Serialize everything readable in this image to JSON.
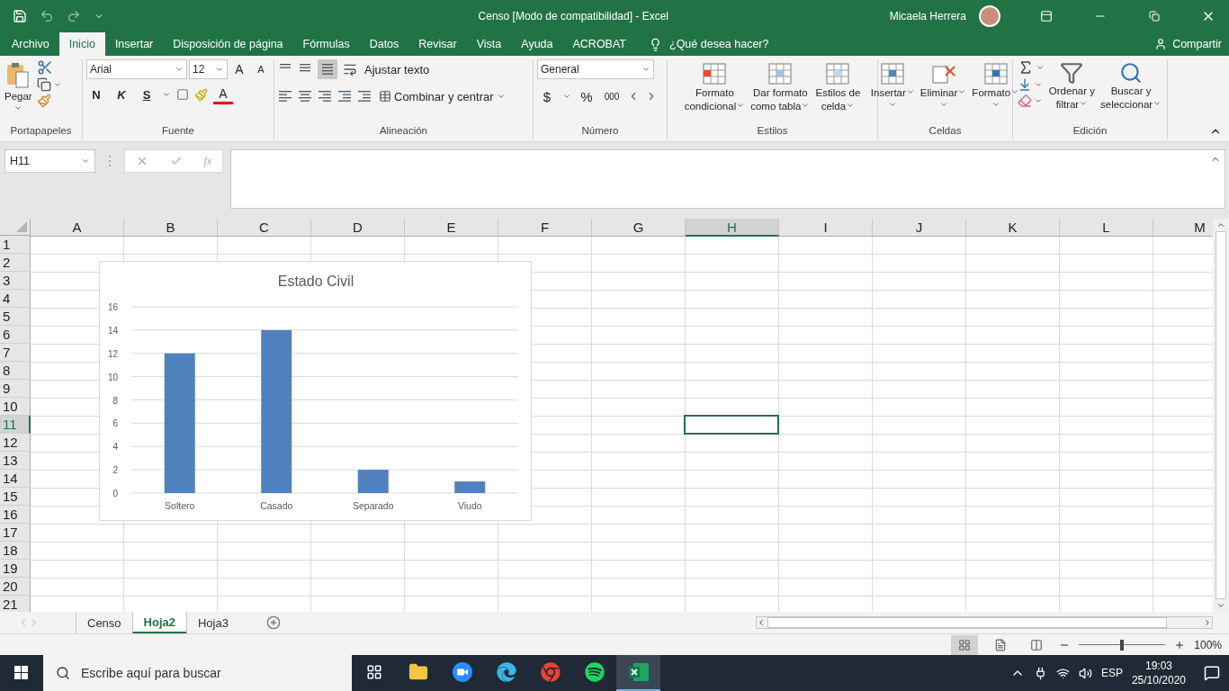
{
  "title_bar": {
    "title": "Censo  [Modo de compatibilidad]  -  Excel",
    "user": "Micaela Herrera"
  },
  "ribbon_tabs": [
    {
      "label": "Archivo",
      "selected": false
    },
    {
      "label": "Inicio",
      "selected": true
    },
    {
      "label": "Insertar",
      "selected": false
    },
    {
      "label": "Disposición de página",
      "selected": false
    },
    {
      "label": "Fórmulas",
      "selected": false
    },
    {
      "label": "Datos",
      "selected": false
    },
    {
      "label": "Revisar",
      "selected": false
    },
    {
      "label": "Vista",
      "selected": false
    },
    {
      "label": "Ayuda",
      "selected": false
    },
    {
      "label": "ACROBAT",
      "selected": false
    }
  ],
  "tell_me": {
    "placeholder": "¿Qué desea hacer?"
  },
  "share": "Compartir",
  "ribbon": {
    "portapapeles": {
      "label": "Portapapeles",
      "paste": "Pegar"
    },
    "fuente": {
      "label": "Fuente",
      "font": "Arial",
      "size": "12",
      "grow": "A",
      "shrink": "A",
      "bold": "N",
      "italic": "K",
      "underline": "S",
      "font_color": "A"
    },
    "alineacion": {
      "label": "Alineación",
      "wrap": "Ajustar texto",
      "merge": "Combinar y centrar"
    },
    "numero": {
      "label": "Número",
      "format": "General",
      "currency": "$",
      "percent": "%",
      "thousands": "000"
    },
    "estilos": {
      "label": "Estilos",
      "buttons": [
        {
          "kind": "conditional",
          "lines": [
            "Formato",
            "condicional"
          ]
        },
        {
          "kind": "table",
          "lines": [
            "Dar formato",
            "como tabla"
          ]
        },
        {
          "kind": "cellstyle",
          "lines": [
            "Estilos de",
            "celda"
          ]
        }
      ]
    },
    "celdas": {
      "label": "Celdas",
      "buttons": [
        {
          "kind": "insert",
          "lines": [
            "Insertar"
          ]
        },
        {
          "kind": "delete",
          "lines": [
            "Eliminar"
          ]
        },
        {
          "kind": "format",
          "lines": [
            "Formato"
          ]
        }
      ]
    },
    "edicion": {
      "label": "Edición",
      "buttons": [
        {
          "kind": "sort",
          "lines": [
            "Ordenar y",
            "filtrar"
          ]
        },
        {
          "kind": "find",
          "lines": [
            "Buscar y",
            "seleccionar"
          ]
        }
      ]
    }
  },
  "formula_bar": {
    "name_box": "H11",
    "fx": "fx"
  },
  "columns": [
    {
      "label": "A",
      "selected": false
    },
    {
      "label": "B",
      "selected": false
    },
    {
      "label": "C",
      "selected": false
    },
    {
      "label": "D",
      "selected": false
    },
    {
      "label": "E",
      "selected": false
    },
    {
      "label": "F",
      "selected": false
    },
    {
      "label": "G",
      "selected": false
    },
    {
      "label": "H",
      "selected": true
    },
    {
      "label": "I",
      "selected": false
    },
    {
      "label": "J",
      "selected": false
    },
    {
      "label": "K",
      "selected": false
    },
    {
      "label": "L",
      "selected": false
    },
    {
      "label": "M",
      "selected": false
    }
  ],
  "rows": [
    {
      "label": "1",
      "selected": false
    },
    {
      "label": "2",
      "selected": false
    },
    {
      "label": "3",
      "selected": false
    },
    {
      "label": "4",
      "selected": false
    },
    {
      "label": "5",
      "selected": false
    },
    {
      "label": "6",
      "selected": false
    },
    {
      "label": "7",
      "selected": false
    },
    {
      "label": "8",
      "selected": false
    },
    {
      "label": "9",
      "selected": false
    },
    {
      "label": "10",
      "selected": false
    },
    {
      "label": "11",
      "selected": true
    },
    {
      "label": "12",
      "selected": false
    },
    {
      "label": "13",
      "selected": false
    },
    {
      "label": "14",
      "selected": false
    },
    {
      "label": "15",
      "selected": false
    },
    {
      "label": "16",
      "selected": false
    },
    {
      "label": "17",
      "selected": false
    },
    {
      "label": "18",
      "selected": false
    },
    {
      "label": "19",
      "selected": false
    },
    {
      "label": "20",
      "selected": false
    },
    {
      "label": "21",
      "selected": false
    }
  ],
  "chart": {
    "chart_data": {
      "type": "bar",
      "title": "Estado Civil",
      "categories": [
        "Soltero",
        "Casado",
        "Separado",
        "Viudo"
      ],
      "series": [
        {
          "color": "#4f81bd",
          "values": [
            12,
            14,
            2,
            1
          ]
        }
      ],
      "grid": true,
      "ylim": [
        0,
        16
      ],
      "yticks": [
        0,
        2,
        4,
        6,
        8,
        10,
        12,
        14,
        16
      ]
    }
  },
  "sheet_tabs": [
    {
      "label": "Censo",
      "selected": false
    },
    {
      "label": "Hoja2",
      "selected": true
    },
    {
      "label": "Hoja3",
      "selected": false
    }
  ],
  "status_bar": {
    "zoom": {
      "level": 0.5,
      "reading": "100%"
    }
  },
  "taskbar": {
    "search": {
      "placeholder": "Escribe aquí para buscar"
    },
    "apps": [
      {
        "kind": "taskview",
        "selected": false
      },
      {
        "kind": "explorer",
        "selected": false
      },
      {
        "kind": "zoom",
        "selected": false
      },
      {
        "kind": "edge",
        "selected": false
      },
      {
        "kind": "chrome",
        "selected": false
      },
      {
        "kind": "spotify",
        "selected": false
      },
      {
        "kind": "excel",
        "selected": true
      }
    ],
    "language": "ESP",
    "time": "19:03",
    "date": "25/10/2020"
  }
}
